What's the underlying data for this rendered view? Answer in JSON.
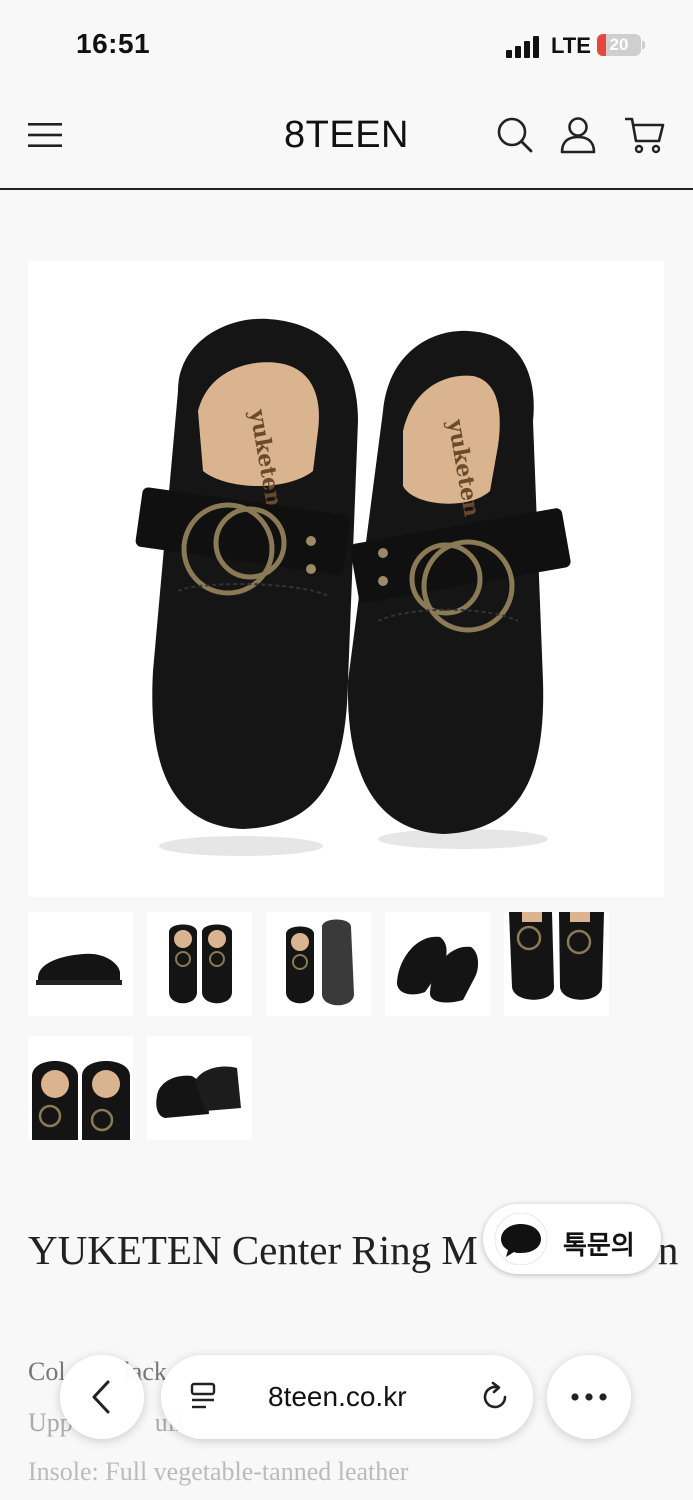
{
  "status_bar": {
    "time": "16:51",
    "network": "LTE",
    "battery": "20",
    "battery_level": 0.2
  },
  "header": {
    "logo": "8TEEN"
  },
  "icons": {
    "menu": "hamburger-menu-icon",
    "search": "search-icon",
    "account": "user-icon",
    "cart": "cart-icon",
    "chat": "speech-bubble-icon",
    "back": "chevron-left-icon",
    "tabs": "reader-list-icon",
    "reload": "reload-icon",
    "more": "ellipsis-icon"
  },
  "gallery": {
    "main_image": "black suede shoe with ring buckle",
    "thumbnails": [
      "side view",
      "top pair view",
      "top and sole view",
      "angled pair view",
      "close-up top view",
      "insole close-up view",
      "side pair view"
    ]
  },
  "product": {
    "title": "YUKETEN Center Ring M",
    "title_tail": "n",
    "specs": {
      "color_a": "Col",
      "color_b": "lack",
      "upper_a": "Upp",
      "upper_b": "ull",
      "insole": "Insole: Full vegetable-tanned leather"
    }
  },
  "chat_button": {
    "label": "톡문의"
  },
  "browser": {
    "url": "8teen.co.kr"
  },
  "colors": {
    "battery_low": "#e8453c",
    "text": "#222222",
    "spec_text": "#999999"
  }
}
